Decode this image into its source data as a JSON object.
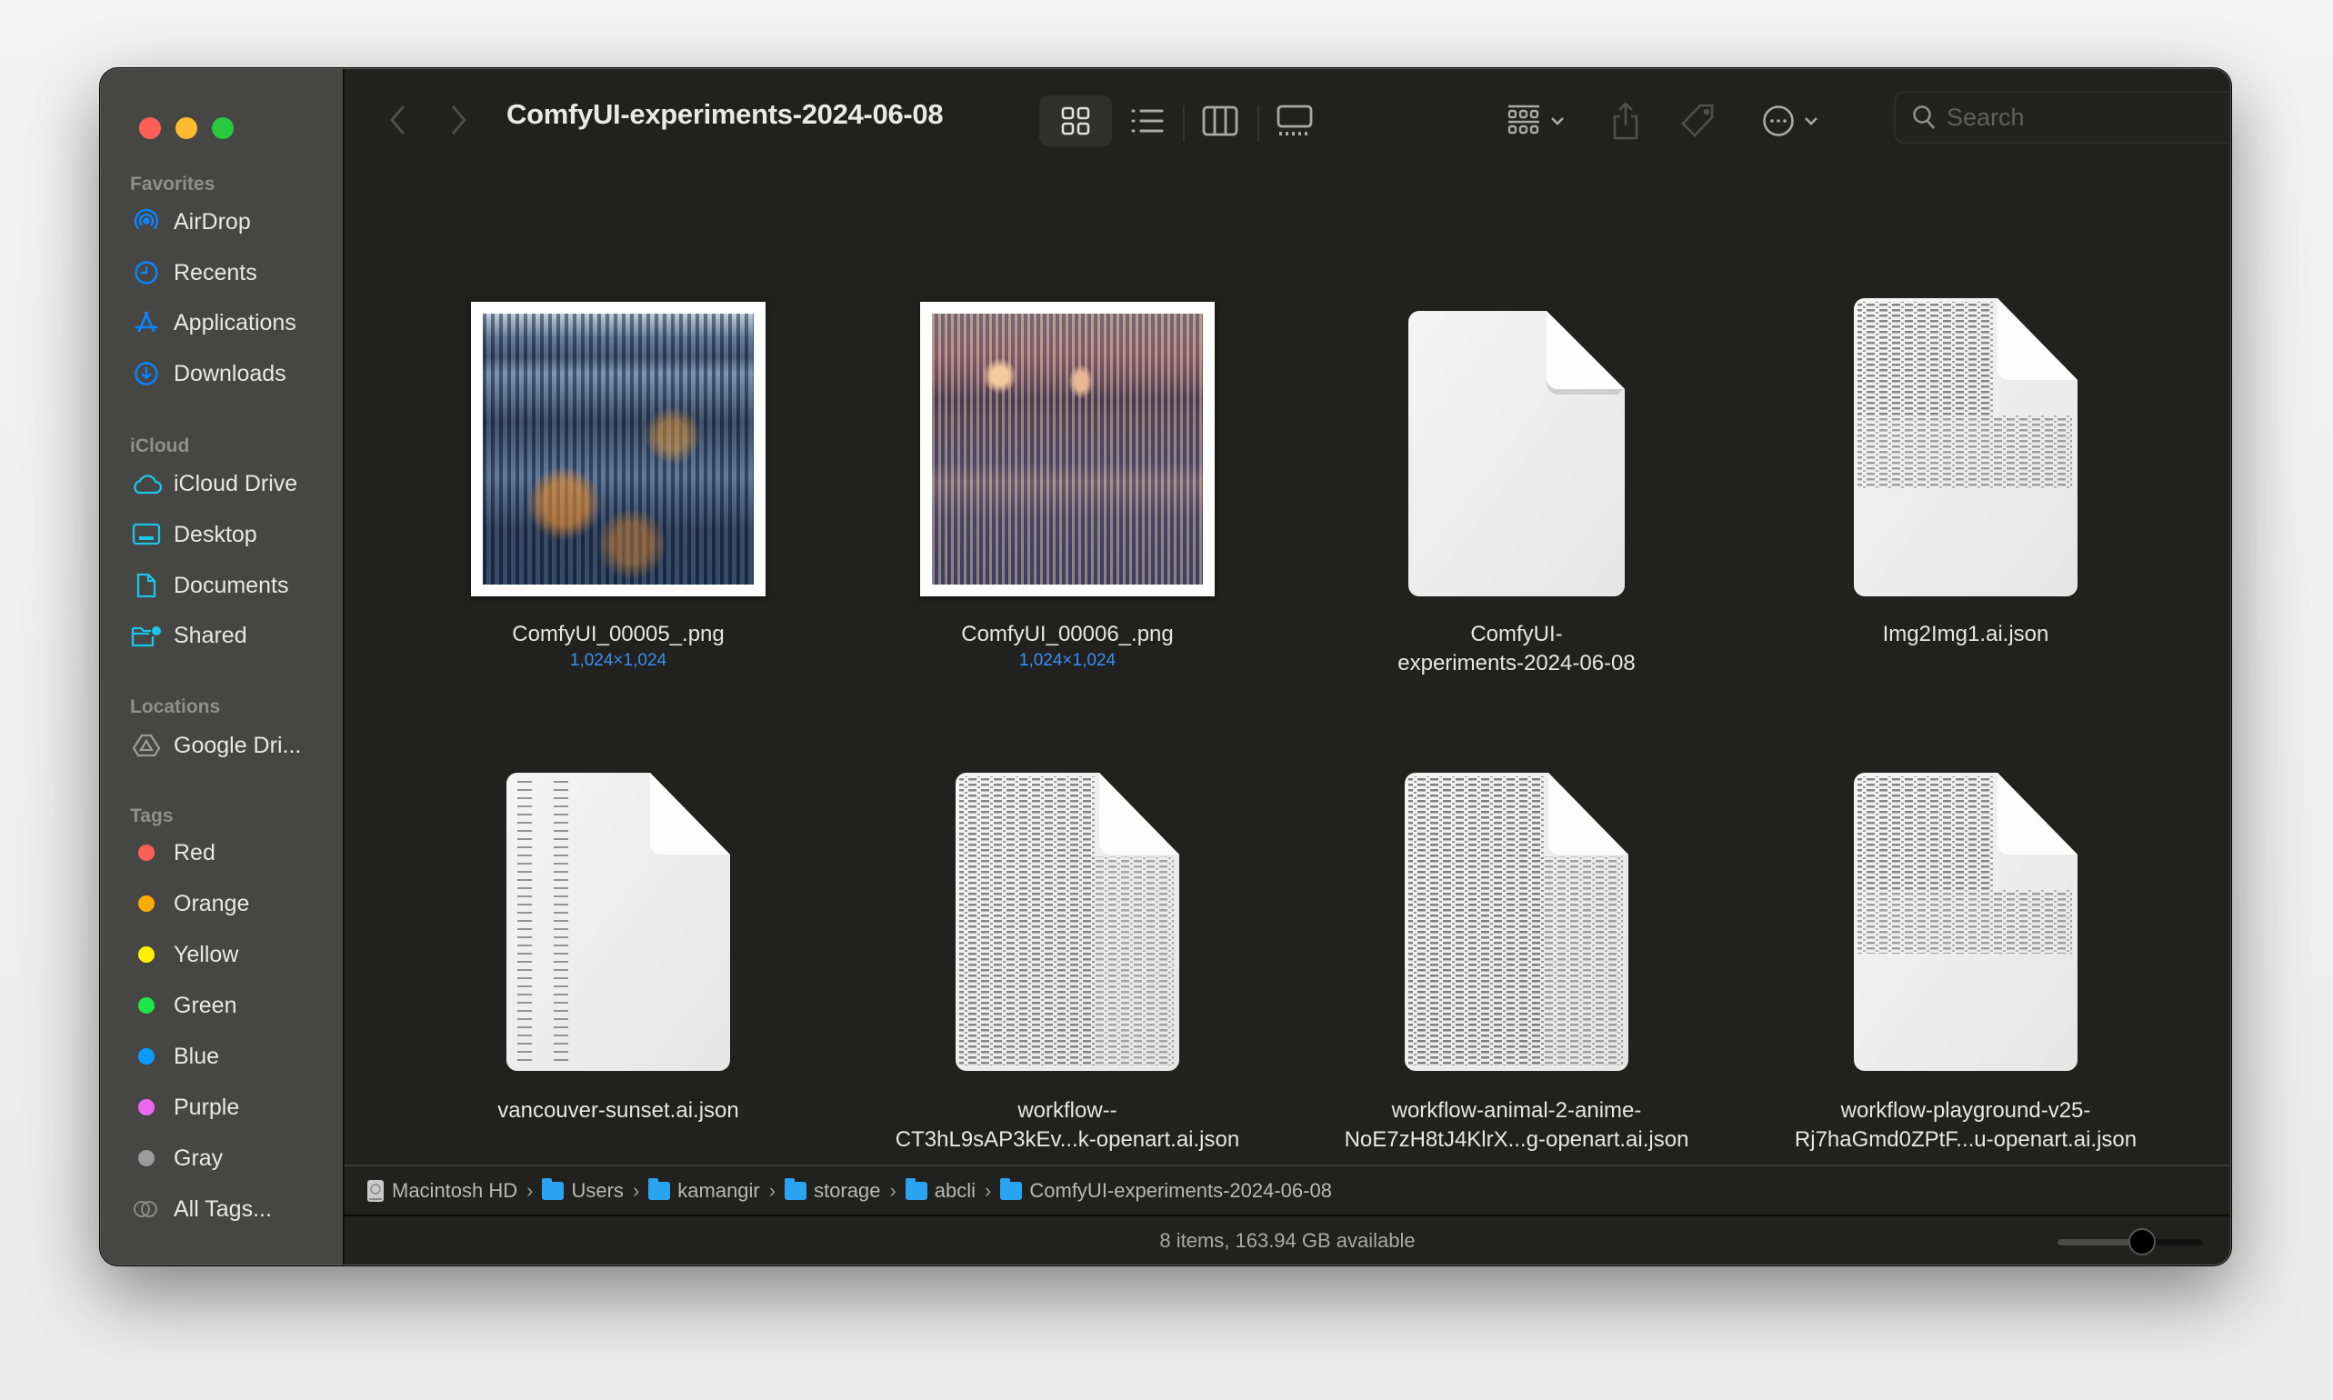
{
  "window": {
    "title": "ComfyUI-experiments-2024-06-08",
    "traffic_lights": {
      "close": "#fe5f57",
      "minimize": "#febc2e",
      "zoom": "#28c840"
    }
  },
  "toolbar": {
    "back_icon": "chevron-left-icon",
    "forward_icon": "chevron-right-icon",
    "view_modes": [
      {
        "name": "icon-view",
        "icon": "grid-icon",
        "selected": true
      },
      {
        "name": "list-view",
        "icon": "list-icon",
        "selected": false
      },
      {
        "name": "column-view",
        "icon": "columns-icon",
        "selected": false
      },
      {
        "name": "gallery-view",
        "icon": "gallery-icon",
        "selected": false
      }
    ],
    "group_icon": "group-by-icon",
    "share_icon": "share-icon",
    "tag_icon": "tag-icon",
    "more_icon": "ellipsis-circle-icon",
    "search": {
      "placeholder": "Search",
      "value": ""
    }
  },
  "sidebar": {
    "sections": [
      {
        "title": "Favorites",
        "items": [
          {
            "label": "AirDrop",
            "icon": "airdrop-icon"
          },
          {
            "label": "Recents",
            "icon": "clock-icon"
          },
          {
            "label": "Applications",
            "icon": "applications-icon"
          },
          {
            "label": "Downloads",
            "icon": "download-icon"
          }
        ]
      },
      {
        "title": "iCloud",
        "items": [
          {
            "label": "iCloud Drive",
            "icon": "cloud-icon"
          },
          {
            "label": "Desktop",
            "icon": "desktop-icon"
          },
          {
            "label": "Documents",
            "icon": "document-icon"
          },
          {
            "label": "Shared",
            "icon": "shared-folder-icon"
          }
        ]
      },
      {
        "title": "Locations",
        "items": [
          {
            "label": "Google Dri...",
            "icon": "google-drive-icon"
          }
        ]
      },
      {
        "title": "Tags",
        "items": [
          {
            "label": "Red",
            "color": "#fe5f57"
          },
          {
            "label": "Orange",
            "color": "#feab02"
          },
          {
            "label": "Yellow",
            "color": "#fef000"
          },
          {
            "label": "Green",
            "color": "#1ee54a"
          },
          {
            "label": "Blue",
            "color": "#0b9cfd"
          },
          {
            "label": "Purple",
            "color": "#ee66f1"
          },
          {
            "label": "Gray",
            "color": "#9b9b9e"
          },
          {
            "label": "All Tags...",
            "icon": "all-tags-icon"
          }
        ]
      }
    ]
  },
  "files": [
    {
      "name": "ComfyUI_00005_.png",
      "name_line2": "",
      "meta": "1,024×1,024",
      "kind": "image-blue"
    },
    {
      "name": "ComfyUI_00006_.png",
      "name_line2": "",
      "meta": "1,024×1,024",
      "kind": "image-sunset"
    },
    {
      "name": "ComfyUI-",
      "name_line2": "experiments-2024-06-08",
      "meta": "",
      "kind": "blank-doc"
    },
    {
      "name": "Img2Img1.ai.json",
      "name_line2": "",
      "meta": "",
      "kind": "text-doc-half"
    },
    {
      "name": "vancouver-sunset.ai.json",
      "name_line2": "",
      "meta": "",
      "kind": "text-doc-sparse"
    },
    {
      "name": "workflow--",
      "name_line2": "CT3hL9sAP3kEv...k-openart.ai.json",
      "meta": "",
      "kind": "text-doc-full"
    },
    {
      "name": "workflow-animal-2-anime-",
      "name_line2": "NoE7zH8tJ4KlrX...g-openart.ai.json",
      "meta": "",
      "kind": "text-doc-full"
    },
    {
      "name": "workflow-playground-v25-",
      "name_line2": "Rj7haGmd0ZPtF...u-openart.ai.json",
      "meta": "",
      "kind": "text-doc-half"
    }
  ],
  "pathbar": [
    {
      "label": "Macintosh HD",
      "icon": "hard-drive-icon"
    },
    {
      "label": "Users",
      "icon": "users-folder-icon"
    },
    {
      "label": "kamangir",
      "icon": "home-folder-icon"
    },
    {
      "label": "storage",
      "icon": "folder-icon"
    },
    {
      "label": "abcli",
      "icon": "folder-icon"
    },
    {
      "label": "ComfyUI-experiments-2024-06-08",
      "icon": "folder-icon"
    }
  ],
  "status": {
    "text": "8 items, 163.94 GB available",
    "icon_size_fraction": 0.6
  }
}
